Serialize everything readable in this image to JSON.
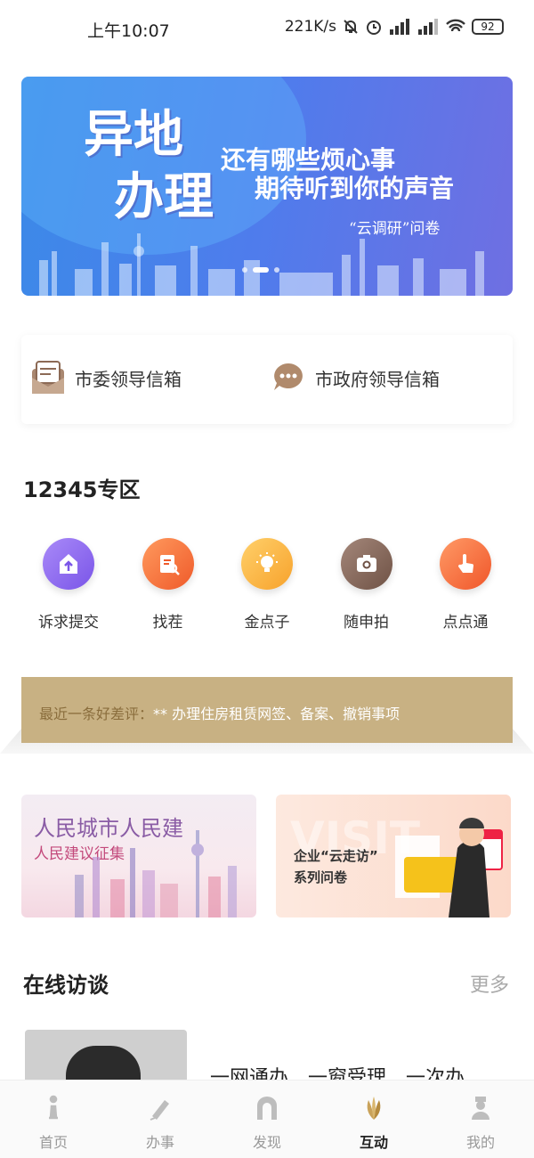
{
  "status_bar": {
    "time": "上午10:07",
    "net_speed": "221K/s",
    "battery": "92"
  },
  "banner": {
    "big_line1": "异地",
    "big_line2": "办理",
    "line1": "还有哪些烦心事",
    "line2": "期待听到你的声音",
    "line3": "“云调研”问卷",
    "page_count": 3,
    "active_page": 1
  },
  "mailboxes": {
    "party": "市委领导信箱",
    "government": "市政府领导信箱"
  },
  "zone": {
    "title": "12345专区",
    "items": [
      {
        "label": "诉求提交",
        "icon": "upload-icon",
        "color": "#8d6cf0"
      },
      {
        "label": "找茬",
        "icon": "clipboard-search-icon",
        "color": "#f36f3e"
      },
      {
        "label": "金点子",
        "icon": "lightbulb-icon",
        "color": "#f9b43a"
      },
      {
        "label": "随申拍",
        "icon": "camera-icon",
        "color": "#8a6a5c"
      },
      {
        "label": "点点通",
        "icon": "tap-finger-icon",
        "color": "#f56a3a"
      }
    ]
  },
  "notice": {
    "prefix": "最近一条好差评：",
    "text": "** 办理住房租赁网签、备案、撤销事项"
  },
  "promo": {
    "left_title": "人民城市人民建",
    "left_sub": "人民建议征集",
    "right_watermark": "VISIT",
    "right_line1": "企业“云走访”",
    "right_line2": "系列问卷"
  },
  "interviews": {
    "title": "在线访谈",
    "more": "更多",
    "first_title": "一网通办、一窗受理、一次办"
  },
  "tabbar": [
    {
      "label": "首页",
      "icon": "tower-icon",
      "active": false
    },
    {
      "label": "办事",
      "icon": "pen-icon",
      "active": false
    },
    {
      "label": "发现",
      "icon": "arch-icon",
      "active": false
    },
    {
      "label": "互动",
      "icon": "magnolia-icon",
      "active": true
    },
    {
      "label": "我的",
      "icon": "person-icon",
      "active": false
    }
  ],
  "colors": {
    "accent": "#c9a25a",
    "notice_bg": "#c8b183",
    "banner_blue": "#4f7cec"
  }
}
